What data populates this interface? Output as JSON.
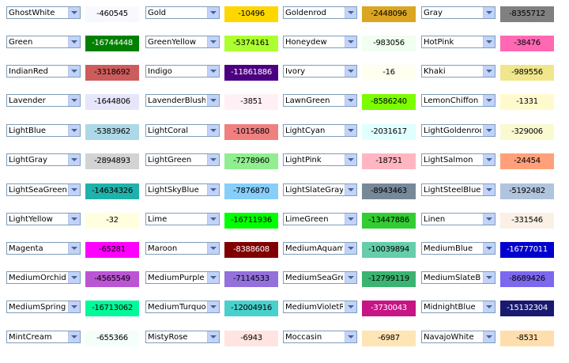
{
  "colors": [
    {
      "name": "GhostWhite",
      "value": "-460545",
      "hex": "#F8F8FF"
    },
    {
      "name": "Gold",
      "value": "-10496",
      "hex": "#FFD700"
    },
    {
      "name": "Goldenrod",
      "value": "-2448096",
      "hex": "#DAA520"
    },
    {
      "name": "Gray",
      "value": "-8355712",
      "hex": "#808080"
    },
    {
      "name": "Green",
      "value": "-16744448",
      "hex": "#008000"
    },
    {
      "name": "GreenYellow",
      "value": "-5374161",
      "hex": "#ADFF2F"
    },
    {
      "name": "Honeydew",
      "value": "-983056",
      "hex": "#F0FFF0"
    },
    {
      "name": "HotPink",
      "value": "-38476",
      "hex": "#FF69B4"
    },
    {
      "name": "IndianRed",
      "value": "-3318692",
      "hex": "#CD5C5C"
    },
    {
      "name": "Indigo",
      "value": "-11861886",
      "hex": "#4B0082"
    },
    {
      "name": "Ivory",
      "value": "-16",
      "hex": "#FFFFF0"
    },
    {
      "name": "Khaki",
      "value": "-989556",
      "hex": "#F0E68C"
    },
    {
      "name": "Lavender",
      "value": "-1644806",
      "hex": "#E6E6FA"
    },
    {
      "name": "LavenderBlush",
      "value": "-3851",
      "hex": "#FFF0F5"
    },
    {
      "name": "LawnGreen",
      "value": "-8586240",
      "hex": "#7CFC00"
    },
    {
      "name": "LemonChiffon",
      "value": "-1331",
      "hex": "#FFFACD"
    },
    {
      "name": "LightBlue",
      "value": "-5383962",
      "hex": "#ADD8E6"
    },
    {
      "name": "LightCoral",
      "value": "-1015680",
      "hex": "#F08080"
    },
    {
      "name": "LightCyan",
      "value": "-2031617",
      "hex": "#E0FFFF"
    },
    {
      "name": "LightGoldenrod",
      "value": "-329006",
      "hex": "#FAFAD2"
    },
    {
      "name": "LightGray",
      "value": "-2894893",
      "hex": "#D3D3D3"
    },
    {
      "name": "LightGreen",
      "value": "-7278960",
      "hex": "#90EE90"
    },
    {
      "name": "LightPink",
      "value": "-18751",
      "hex": "#FFB6C1"
    },
    {
      "name": "LightSalmon",
      "value": "-24454",
      "hex": "#FFA07A"
    },
    {
      "name": "LightSeaGreen",
      "value": "-14634326",
      "hex": "#20B2AA"
    },
    {
      "name": "LightSkyBlue",
      "value": "-7876870",
      "hex": "#87CEFA"
    },
    {
      "name": "LightSlateGray",
      "value": "-8943463",
      "hex": "#778899"
    },
    {
      "name": "LightSteelBlue",
      "value": "-5192482",
      "hex": "#B0C4DE"
    },
    {
      "name": "LightYellow",
      "value": "-32",
      "hex": "#FFFFE0"
    },
    {
      "name": "Lime",
      "value": "-16711936",
      "hex": "#00FF00"
    },
    {
      "name": "LimeGreen",
      "value": "-13447886",
      "hex": "#32CD32"
    },
    {
      "name": "Linen",
      "value": "-331546",
      "hex": "#FAF0E6"
    },
    {
      "name": "Magenta",
      "value": "-65281",
      "hex": "#FF00FF"
    },
    {
      "name": "Maroon",
      "value": "-8388608",
      "hex": "#800000"
    },
    {
      "name": "MediumAquamarine",
      "value": "-10039894",
      "hex": "#66CDAA"
    },
    {
      "name": "MediumBlue",
      "value": "-16777011",
      "hex": "#0000CD"
    },
    {
      "name": "MediumOrchid",
      "value": "-4565549",
      "hex": "#BA55D3"
    },
    {
      "name": "MediumPurple",
      "value": "-7114533",
      "hex": "#9370DB"
    },
    {
      "name": "MediumSeaGreen",
      "value": "-12799119",
      "hex": "#3CB371"
    },
    {
      "name": "MediumSlateBlue",
      "value": "-8689426",
      "hex": "#7B68EE"
    },
    {
      "name": "MediumSpringGreen",
      "value": "-16713062",
      "hex": "#00FA9A"
    },
    {
      "name": "MediumTurquoise",
      "value": "-12004916",
      "hex": "#48D1CC"
    },
    {
      "name": "MediumVioletRed",
      "value": "-3730043",
      "hex": "#C71585"
    },
    {
      "name": "MidnightBlue",
      "value": "-15132304",
      "hex": "#191970"
    },
    {
      "name": "MintCream",
      "value": "-655366",
      "hex": "#F5FFFA"
    },
    {
      "name": "MistyRose",
      "value": "-6943",
      "hex": "#FFE4E1"
    },
    {
      "name": "Moccasin",
      "value": "-6987",
      "hex": "#FFE4B5"
    },
    {
      "name": "NavajoWhite",
      "value": "-8531",
      "hex": "#FFDEAD"
    }
  ],
  "dark_text_colors": [
    "#008000",
    "#4B0082",
    "#800000",
    "#0000CD",
    "#191970",
    "#C71585"
  ],
  "dropdown_icon": "chevron-down-icon"
}
